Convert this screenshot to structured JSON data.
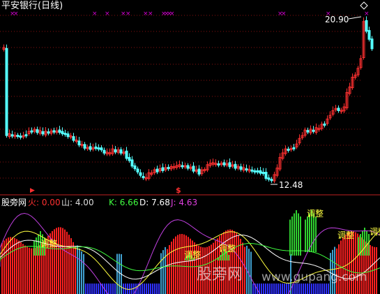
{
  "main": {
    "title": "平安银行(日线)",
    "high_label": "20.90",
    "low_label": "12.48",
    "signal_symbol": "$",
    "colors": {
      "up": "#ff3030",
      "down": "#54ffff",
      "grid": "#8a1010",
      "marker": "#d000d0"
    }
  },
  "indicator": {
    "name": "股旁网",
    "fields": [
      {
        "label": "火:",
        "value": "0.00",
        "color": "#ff3030"
      },
      {
        "label": "山:",
        "value": "4.00",
        "color": "#dddddd"
      },
      {
        "label": "K:",
        "value": "6.66",
        "color": "#40ff40"
      },
      {
        "label": "D:",
        "value": "7.68",
        "color": "#ffffff"
      },
      {
        "label": "J:",
        "value": "4.63",
        "color": "#e040e0"
      }
    ],
    "adjust_label": "调整"
  },
  "watermark": {
    "cn": "股旁网",
    "url": "www.gupang.com"
  }
}
